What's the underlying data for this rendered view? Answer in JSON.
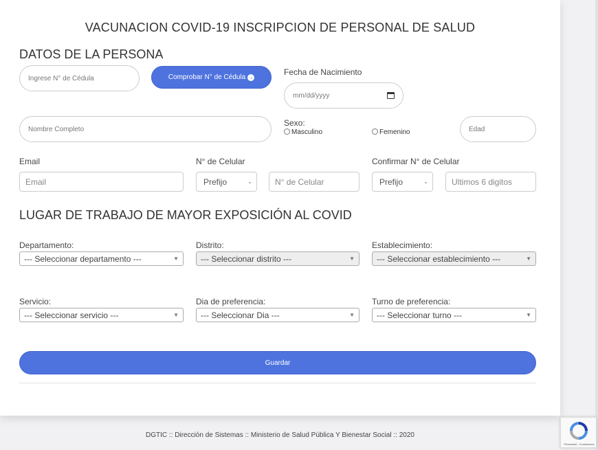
{
  "title": "VACUNACION COVID-19 INSCRIPCION DE PERSONAL DE SALUD",
  "persona": {
    "heading": "DATOS DE LA PERSONA",
    "cedula_placeholder": "Ingrese N° de Cédula",
    "check_button": "Comprobar N° de Cédula",
    "birth_label": "Fecha de Nacimiento",
    "birth_placeholder": "mm/dd/yyyy",
    "name_placeholder": "Nombre Completo",
    "sexo_label": "Sexo:",
    "sexo_options": [
      "Masculino",
      "Femenino"
    ],
    "edad_placeholder": "Edad",
    "email_label": "Email",
    "email_placeholder": "Email",
    "celular_label": "N° de Celular",
    "prefijo": "Prefijo",
    "celular_placeholder": "N° de Celular",
    "confirm_label": "Confirmar N° de Celular",
    "confirm_prefijo": "Prefijo",
    "confirm_placeholder": "Ultimos 6 digitos"
  },
  "trabajo": {
    "heading": "LUGAR DE TRABAJO DE MAYOR EXPOSICIÓN AL COVID",
    "departamento_label": "Departamento:",
    "departamento_value": "--- Seleccionar departamento ---",
    "distrito_label": "Distrito:",
    "distrito_value": "--- Seleccionar distrito ---",
    "establecimiento_label": "Establecimiento:",
    "establecimiento_value": "--- Seleccionar establecimiento ---",
    "servicio_label": "Servicio:",
    "servicio_value": "--- Seleccionar servicio ---",
    "dia_label": "Dia de preferencia:",
    "dia_value": "--- Seleccionar Dia ---",
    "turno_label": "Turno de preferencia:",
    "turno_value": "--- Seleccionar turno ---"
  },
  "save_button": "Guardar",
  "footer": "DGTIC :: Dirección de Sistemas :: Ministerio de Salud Pública Y Bienestar Social :: 2020",
  "recaptcha_text": "Privacidad - Condiciones",
  "colors": {
    "primary": "#4e73df",
    "background": "#f1f1f3"
  }
}
